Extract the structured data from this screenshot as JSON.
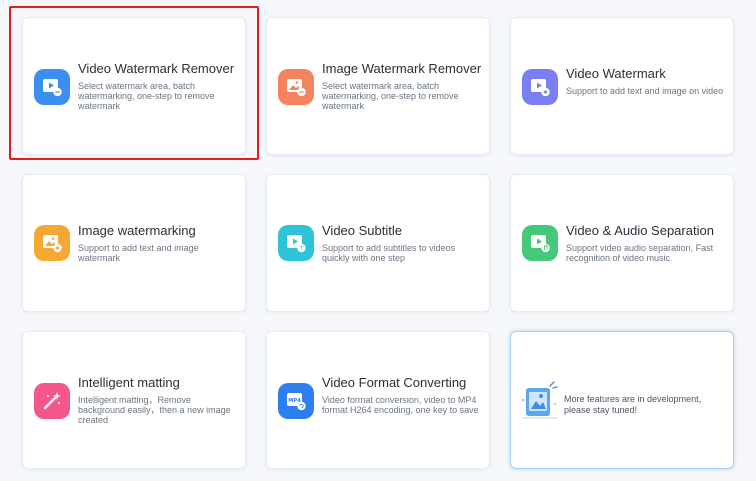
{
  "tools": [
    {
      "title": "Video Watermark Remover",
      "desc": "Select watermark area, batch watermarking, one-step to remove watermark",
      "icon": "video-remove-icon",
      "color": "#3b8ff0"
    },
    {
      "title": "Image Watermark Remover",
      "desc": "Select watermark area, batch watermarking, one-step to remove watermark",
      "icon": "image-remove-icon",
      "color": "#f4845f"
    },
    {
      "title": "Video Watermark",
      "desc": "Support to add text and image on video",
      "icon": "video-watermark-icon",
      "color": "#7b7ff3"
    },
    {
      "title": "Image watermarking",
      "desc": "Support to add text and image watermark",
      "icon": "image-watermark-icon",
      "color": "#f6a833"
    },
    {
      "title": "Video Subtitle",
      "desc": "Support to add subtitles to videos quickly with one step",
      "icon": "subtitle-icon",
      "color": "#2ec4d8"
    },
    {
      "title": "Video & Audio Separation",
      "desc": "Support video audio separation, Fast recognition of video music",
      "icon": "audio-separation-icon",
      "color": "#44c87a"
    },
    {
      "title": "Intelligent matting",
      "desc": "Intelligent matting，Remove background easily，then a new image created",
      "icon": "magic-wand-icon",
      "color": "#f5578a"
    },
    {
      "title": "Video Format Converting",
      "desc": "Video format conversion, video to MP4 format H264 encoding, one key to save",
      "icon": "mp4-icon",
      "color": "#2d7ff0",
      "icon_label": "MP4"
    }
  ],
  "coming_soon": {
    "text": "More features are in development, please stay tuned!"
  }
}
